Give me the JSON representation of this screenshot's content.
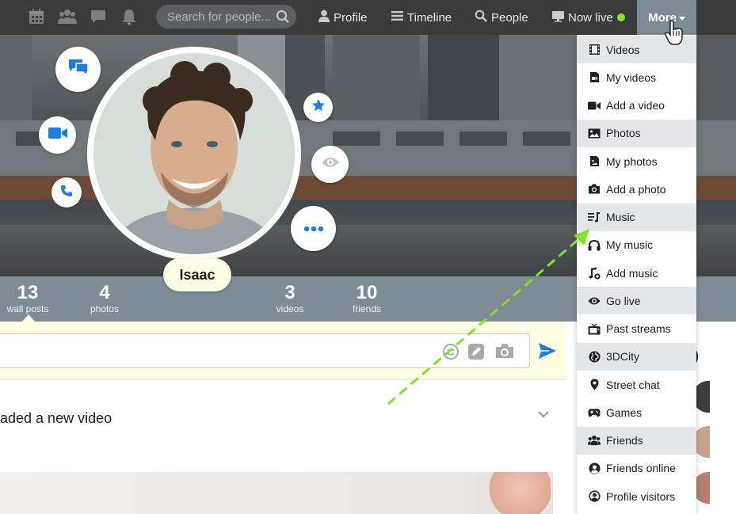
{
  "nav": {
    "icons": [
      "calendar-icon",
      "users-icon",
      "chat-icon",
      "bell-icon"
    ],
    "search_placeholder": "Search for people...",
    "links": {
      "profile": "Profile",
      "timeline": "Timeline",
      "people": "People",
      "now_live": "Now live",
      "more": "More"
    },
    "live_dot_color": "#8ee03a"
  },
  "profile": {
    "name": "Isaac",
    "action_buttons": [
      "chat-bubble-icon",
      "video-camera-icon",
      "phone-icon",
      "star-icon",
      "eye-icon",
      "more-dots-icon"
    ],
    "accent_color": "#1b7fe3"
  },
  "stats": [
    {
      "num": "13",
      "label": "wall posts"
    },
    {
      "num": "4",
      "label": "photos"
    },
    {
      "num": "3",
      "label": "videos"
    },
    {
      "num": "10",
      "label": "friends"
    }
  ],
  "composer": {
    "icons": [
      "emoji-icon",
      "pencil-icon",
      "camera-icon",
      "send-icon"
    ]
  },
  "feed": {
    "post_text": "aded a new video"
  },
  "right_column": {
    "heading_fragment": ")"
  },
  "dropdown": {
    "items": [
      {
        "label": "Videos",
        "icon": "film-icon",
        "section": true
      },
      {
        "label": "My videos",
        "icon": "file-video-icon",
        "section": false
      },
      {
        "label": "Add a video",
        "icon": "video-camera-icon",
        "section": false
      },
      {
        "label": "Photos",
        "icon": "image-icon",
        "section": true
      },
      {
        "label": "My photos",
        "icon": "file-image-icon",
        "section": false
      },
      {
        "label": "Add a photo",
        "icon": "camera-icon",
        "section": false
      },
      {
        "label": "Music",
        "icon": "music-list-icon",
        "section": true
      },
      {
        "label": "My music",
        "icon": "headphones-icon",
        "section": false
      },
      {
        "label": "Add music",
        "icon": "music-add-icon",
        "section": false
      },
      {
        "label": "Go live",
        "icon": "eye-icon",
        "section": true
      },
      {
        "label": "Past streams",
        "icon": "tv-icon",
        "section": false
      },
      {
        "label": "3DCity",
        "icon": "globe-icon",
        "section": true
      },
      {
        "label": "Street chat",
        "icon": "map-pin-icon",
        "section": false
      },
      {
        "label": "Games",
        "icon": "gamepad-icon",
        "section": false
      },
      {
        "label": "Friends",
        "icon": "users-icon",
        "section": true
      },
      {
        "label": "Friends online",
        "icon": "user-circle-icon",
        "section": false
      },
      {
        "label": "Profile visitors",
        "icon": "user-circle-outline-icon",
        "section": false
      }
    ]
  },
  "annotation": {
    "arrow_color": "#7ee52a"
  }
}
